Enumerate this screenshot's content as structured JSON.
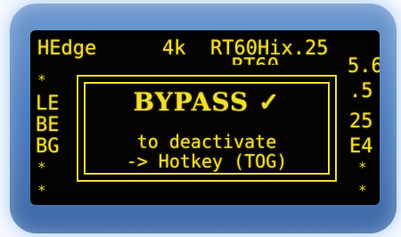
{
  "display": {
    "top_row": {
      "label": "HEdge",
      "value": "4k",
      "param": "RT60Hix.25"
    },
    "second_row_right_peek": "RT60",
    "right_values": [
      "5.6",
      ".5",
      "25",
      "E4"
    ],
    "left_labels": [
      "LE",
      "BE",
      "BG"
    ],
    "star_glyph": "*"
  },
  "overlay": {
    "title": "BYPASS ✓",
    "line1": "to deactivate",
    "line2": "-> Hotkey (TOG)"
  },
  "colors": {
    "text": "#f3de2b",
    "screen_bg": "#050403",
    "bezel": "#4f7fbf"
  }
}
